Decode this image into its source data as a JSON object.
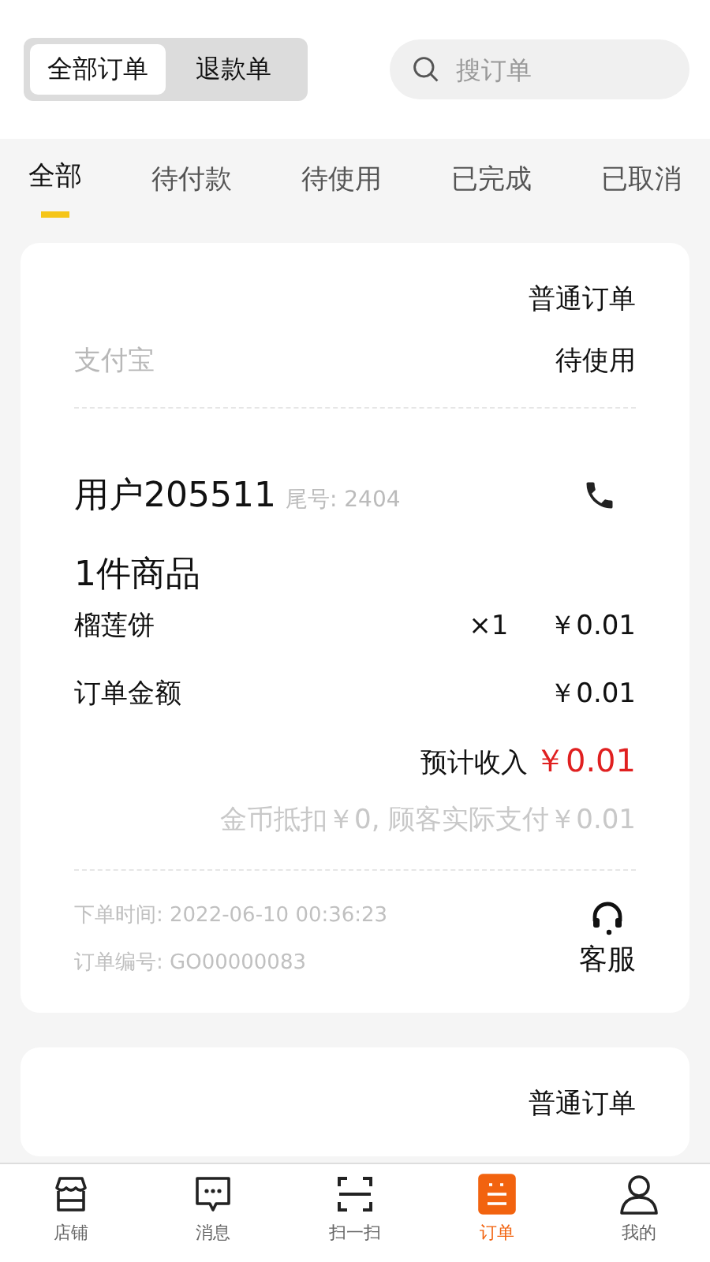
{
  "segments": [
    {
      "label": "全部订单",
      "selected": true
    },
    {
      "label": "退款单",
      "selected": false
    }
  ],
  "search": {
    "placeholder": "搜订单"
  },
  "tabs": [
    {
      "label": "全部",
      "selected": true
    },
    {
      "label": "待付款",
      "selected": false
    },
    {
      "label": "待使用",
      "selected": false
    },
    {
      "label": "已完成",
      "selected": false
    },
    {
      "label": "已取消",
      "selected": false
    }
  ],
  "orders": [
    {
      "type": "普通订单",
      "payment": "支付宝",
      "status": "待使用",
      "customer": "用户205511",
      "tail": "尾号: 2404",
      "item_count": "1件商品",
      "items": [
        {
          "name": "榴莲饼",
          "qty": "×1",
          "price": "￥0.01"
        }
      ],
      "amount_label": "订单金额",
      "amount": "￥0.01",
      "income_label": "预计收入",
      "income": "￥0.01",
      "note": "金币抵扣￥0, 顾客实际支付￥0.01",
      "time": "下单时间: 2022-06-10 00:36:23",
      "number": "订单编号: GO00000083",
      "service": "客服"
    },
    {
      "type": "普通订单"
    }
  ],
  "nav": [
    {
      "label": "店铺",
      "selected": false
    },
    {
      "label": "消息",
      "selected": false
    },
    {
      "label": "扫一扫",
      "selected": false
    },
    {
      "label": "订单",
      "selected": true
    },
    {
      "label": "我的",
      "selected": false
    }
  ]
}
